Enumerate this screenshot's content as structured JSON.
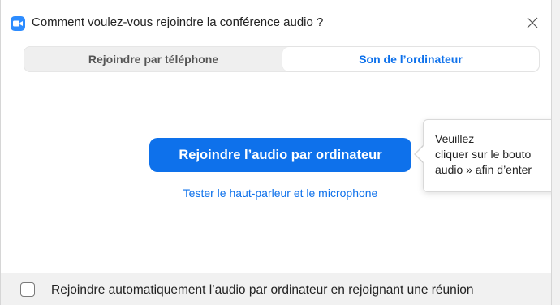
{
  "window": {
    "title": "Comment voulez-vous rejoindre la conférence audio ?"
  },
  "tabs": [
    {
      "label": "Rejoindre par téléphone",
      "selected": false
    },
    {
      "label": "Son de l’ordinateur",
      "selected": true
    }
  ],
  "main": {
    "join_button_label": "Rejoindre l’audio par ordinateur",
    "test_link_label": "Tester le haut-parleur et le microphone"
  },
  "tooltip": {
    "lines": [
      "Veuillez",
      "cliquer sur le bouto",
      "audio » afin d’enter"
    ]
  },
  "footer": {
    "auto_join_label": "Rejoindre automatiquement l’audio par ordinateur en rejoignant une réunion",
    "auto_join_checked": false
  },
  "colors": {
    "accent": "#0e71eb",
    "app_icon": "#2d8cff",
    "footer_bg": "#f1f1f1"
  },
  "icons": {
    "app": "zoom-camera-icon",
    "close": "close-icon"
  }
}
